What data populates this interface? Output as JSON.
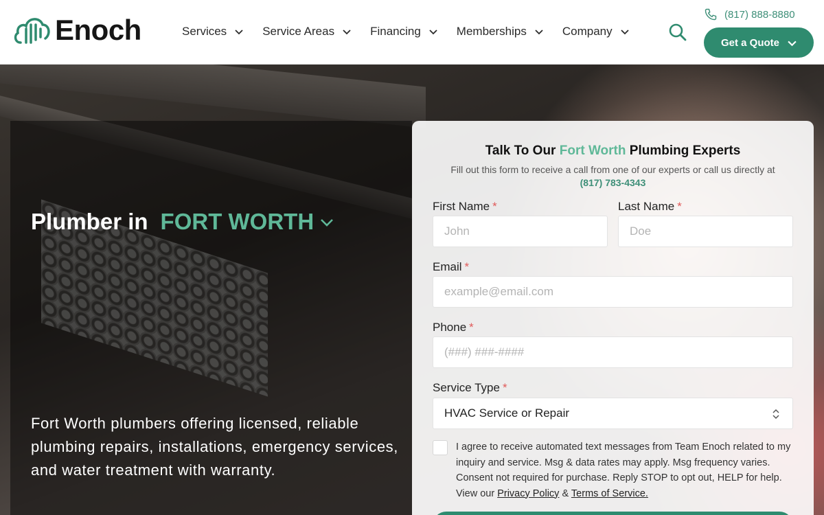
{
  "brand": {
    "name": "Enoch",
    "accent": "#2f8b6f",
    "accent_light": "#5fb898"
  },
  "nav": {
    "items": [
      {
        "label": "Services"
      },
      {
        "label": "Service Areas"
      },
      {
        "label": "Financing"
      },
      {
        "label": "Memberships"
      },
      {
        "label": "Company"
      }
    ],
    "search_icon": "search-icon"
  },
  "header": {
    "phone": "(817) 888-8880",
    "quote_label": "Get a Quote"
  },
  "hero": {
    "title_prefix": "Plumber in",
    "city": "FORT WORTH",
    "description": "Fort Worth plumbers offering licensed, reliable plumbing repairs, installations, emergency services, and water treatment with warranty."
  },
  "form": {
    "title_prefix": "Talk To Our",
    "title_city": "Fort Worth",
    "title_suffix": "Plumbing Experts",
    "subtitle": "Fill out this form to receive a call from one of our experts or call us directly at",
    "phone": "(817) 783-4343",
    "required_mark": "*",
    "first_name": {
      "label": "First Name",
      "placeholder": "John"
    },
    "last_name": {
      "label": "Last Name",
      "placeholder": "Doe"
    },
    "email": {
      "label": "Email",
      "placeholder": "example@email.com"
    },
    "phone_field": {
      "label": "Phone",
      "placeholder": "(###) ###-####"
    },
    "service_type": {
      "label": "Service Type",
      "value": "HVAC Service or Repair"
    },
    "consent": {
      "text": "I agree to receive automated text messages from Team Enoch related to my inquiry and service. Msg & data rates may apply. Msg frequency varies. Consent not required for purchase. Reply STOP to opt out, HELP for help. View our",
      "privacy_link": "Privacy Policy",
      "amp": "&",
      "terms_link": "Terms of Service."
    }
  }
}
